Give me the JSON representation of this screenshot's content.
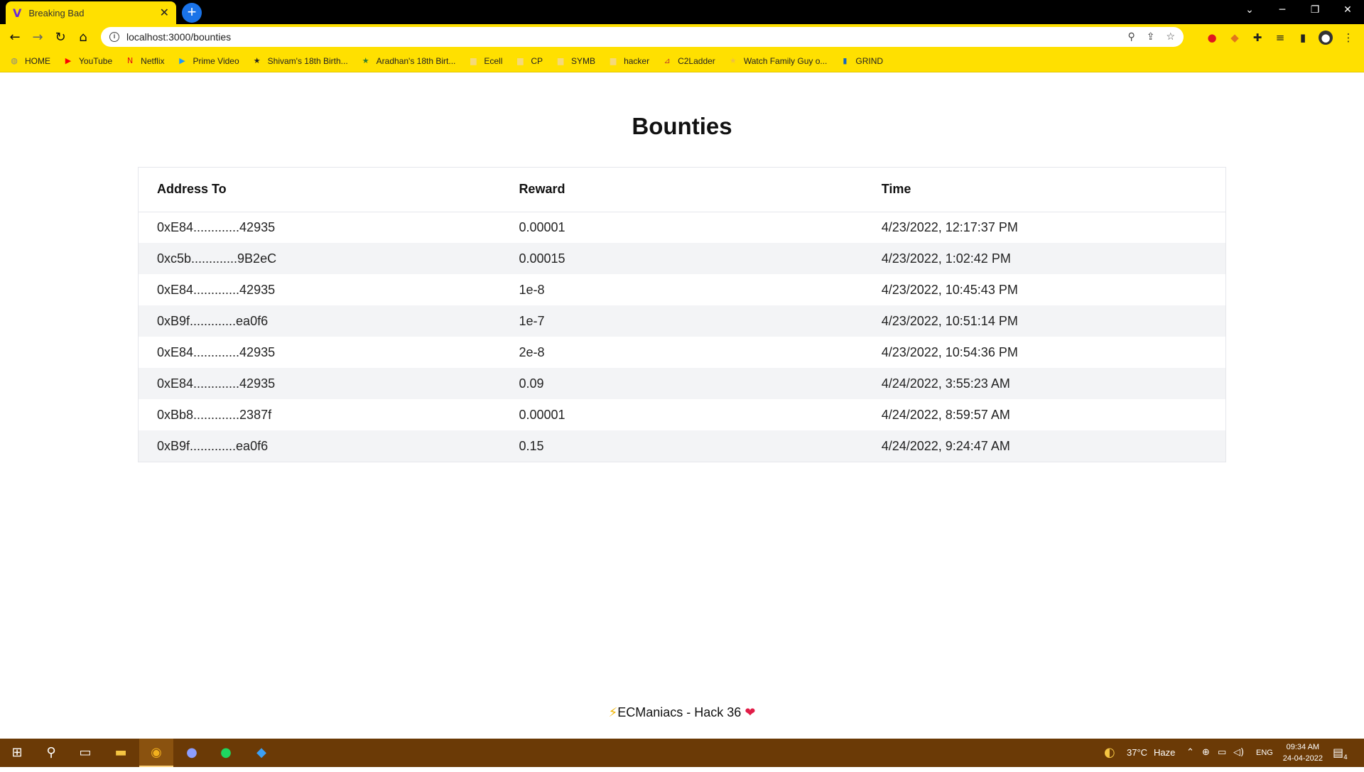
{
  "browser": {
    "tab_title": "Breaking Bad",
    "url": "localhost:3000/bounties",
    "bookmarks": [
      {
        "label": "HOME",
        "icon": "globe-icon",
        "color": "#888888"
      },
      {
        "label": "YouTube",
        "icon": "youtube-icon",
        "color": "#ff0000"
      },
      {
        "label": "Netflix",
        "icon": "netflix-icon",
        "color": "#e50914"
      },
      {
        "label": "Prime Video",
        "icon": "prime-video-icon",
        "color": "#1a98ff"
      },
      {
        "label": "Shivam's 18th Birth...",
        "icon": "bookmark-icon",
        "color": "#222222"
      },
      {
        "label": "Aradhan's 18th Birt...",
        "icon": "bookmark-icon",
        "color": "#2e7d32"
      },
      {
        "label": "Ecell",
        "icon": "folder-icon",
        "color": "#f5d97a"
      },
      {
        "label": "CP",
        "icon": "folder-icon",
        "color": "#f5d97a"
      },
      {
        "label": "SYMB",
        "icon": "folder-icon",
        "color": "#f5d97a"
      },
      {
        "label": "hacker",
        "icon": "folder-icon",
        "color": "#f5d97a"
      },
      {
        "label": "C2Ladder",
        "icon": "ladder-icon",
        "color": "#c0392b"
      },
      {
        "label": "Watch Family Guy o...",
        "icon": "bookmark-icon",
        "color": "#f0c040"
      },
      {
        "label": "GRIND",
        "icon": "bar-chart-icon",
        "color": "#1565c0"
      }
    ]
  },
  "page": {
    "title": "Bounties",
    "columns": [
      "Address To",
      "Reward",
      "Time"
    ],
    "rows": [
      {
        "address": "0xE84.............42935",
        "reward": "0.00001",
        "time": "4/23/2022, 12:17:37 PM"
      },
      {
        "address": "0xc5b.............9B2eC",
        "reward": "0.00015",
        "time": "4/23/2022, 1:02:42 PM"
      },
      {
        "address": "0xE84.............42935",
        "reward": "1e-8",
        "time": "4/23/2022, 10:45:43 PM"
      },
      {
        "address": "0xB9f.............ea0f6",
        "reward": "1e-7",
        "time": "4/23/2022, 10:51:14 PM"
      },
      {
        "address": "0xE84.............42935",
        "reward": "2e-8",
        "time": "4/23/2022, 10:54:36 PM"
      },
      {
        "address": "0xE84.............42935",
        "reward": "0.09",
        "time": "4/24/2022, 3:55:23 AM"
      },
      {
        "address": "0xBb8.............2387f",
        "reward": "0.00001",
        "time": "4/24/2022, 8:59:57 AM"
      },
      {
        "address": "0xB9f.............ea0f6",
        "reward": "0.15",
        "time": "4/24/2022, 9:24:47 AM"
      }
    ],
    "footer": "ECManiacs - Hack 36"
  },
  "taskbar": {
    "weather_temp": "37°C",
    "weather_desc": "Haze",
    "language": "ENG",
    "time": "09:34 AM",
    "date": "24-04-2022",
    "notification_count": "4"
  },
  "colors": {
    "chrome_accent": "#ffe000",
    "taskbar_bg": "#6b3a06",
    "table_stripe": "#f3f4f6"
  }
}
